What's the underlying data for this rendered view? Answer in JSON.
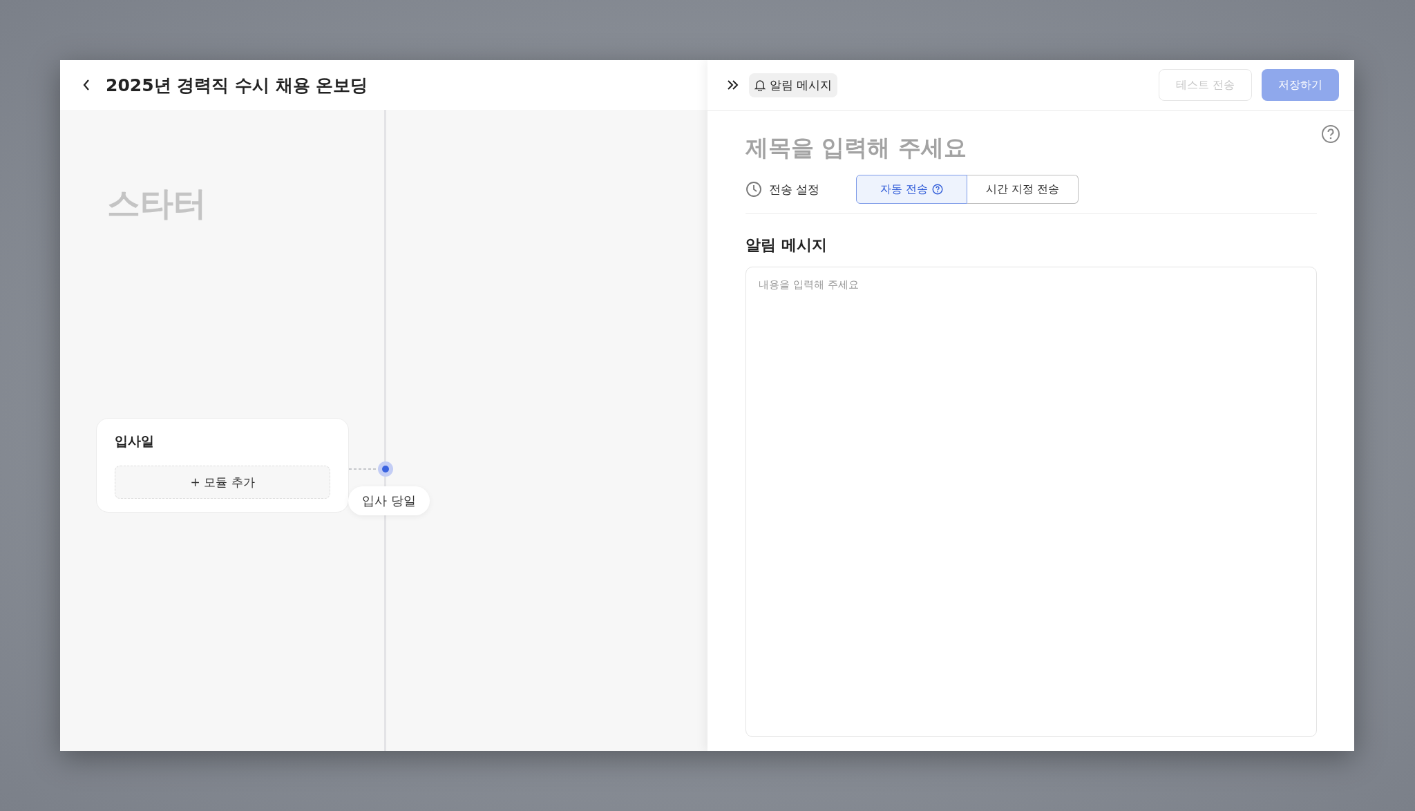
{
  "header": {
    "title": "2025년 경력직 수시 채용 온보딩"
  },
  "canvas": {
    "stage_label": "스타터",
    "card": {
      "title": "입사일",
      "add_button": "+ 모듈 추가"
    },
    "node": {
      "label": "입사 당일"
    }
  },
  "panel": {
    "chip": "알림 메시지",
    "buttons": [
      {
        "label": "테스트 전송",
        "kind": "outline",
        "disabled": true
      },
      {
        "label": "저장하기",
        "kind": "primary",
        "disabled": true
      }
    ],
    "title_placeholder": "제목을 입력해 주세요",
    "send_label": "전송 설정",
    "segments": [
      {
        "label": "자동 전송",
        "selected": true,
        "help_icon": true
      },
      {
        "label": "시간 지정 전송",
        "selected": false,
        "help_icon": false
      }
    ],
    "message_heading": "알림 메시지",
    "message_placeholder": "내용을 입력해 주세요"
  }
}
